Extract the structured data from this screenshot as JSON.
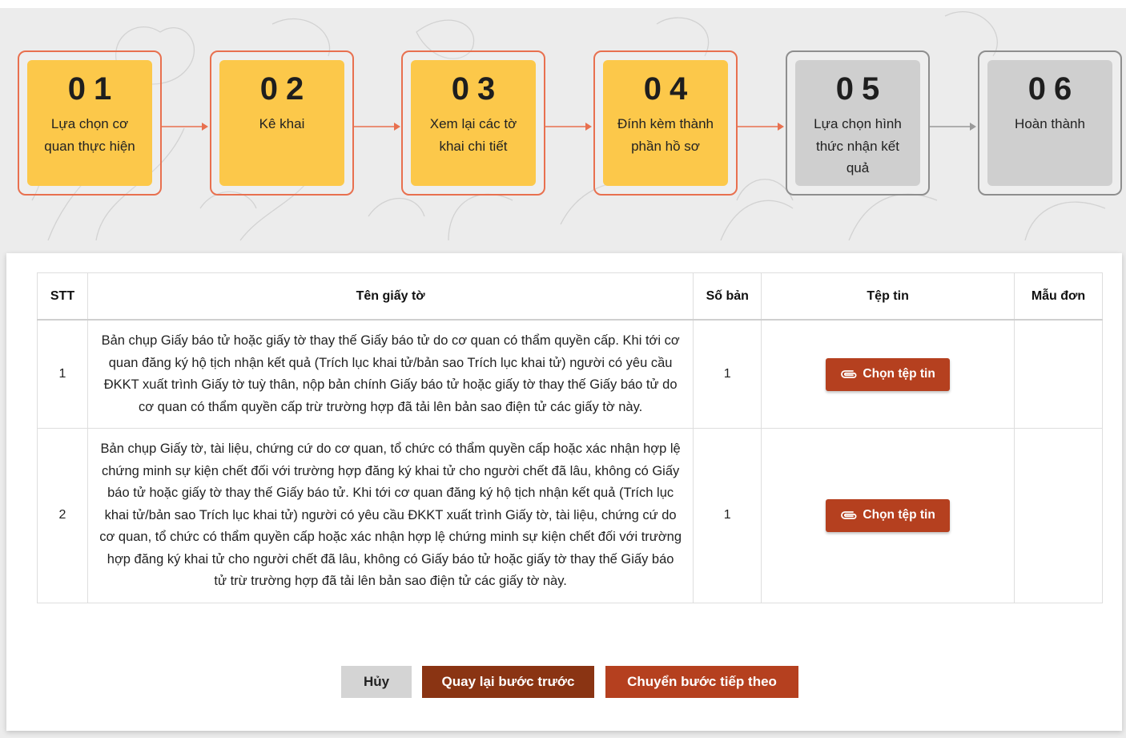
{
  "steps": [
    {
      "num": "01",
      "label": "Lựa chọn cơ quan thực hiện",
      "state": "done"
    },
    {
      "num": "02",
      "label": "Kê khai",
      "state": "done"
    },
    {
      "num": "03",
      "label": "Xem lại các tờ khai chi tiết",
      "state": "done"
    },
    {
      "num": "04",
      "label": "Đính kèm thành phần hồ sơ",
      "state": "active"
    },
    {
      "num": "05",
      "label": "Lựa chọn hình thức nhận kết quả",
      "state": "pending"
    },
    {
      "num": "06",
      "label": "Hoàn thành",
      "state": "pending"
    }
  ],
  "table": {
    "headers": {
      "stt": "STT",
      "name": "Tên giấy tờ",
      "copies": "Số bản",
      "file": "Tệp tin",
      "template": "Mẫu đơn"
    },
    "rows": [
      {
        "stt": "1",
        "name": "Bản chụp Giấy báo tử hoặc giấy tờ thay thế Giấy báo tử do cơ quan có thẩm quyền cấp. Khi tới cơ quan đăng ký hộ tịch nhận kết quả (Trích lục khai tử/bản sao Trích lục khai tử) người có yêu cầu ĐKKT xuất trình Giấy tờ tuỳ thân, nộp bản chính Giấy báo tử hoặc giấy tờ thay thế Giấy báo tử do cơ quan có thẩm quyền cấp trừ trường hợp đã tải lên bản sao điện tử các giấy tờ này.",
        "copies": "1",
        "file_button": "Chọn tệp tin",
        "template": ""
      },
      {
        "stt": "2",
        "name": "Bản chụp Giấy tờ, tài liệu, chứng cứ do cơ quan, tổ chức có thẩm quyền cấp hoặc xác nhận hợp lệ chứng minh sự kiện chết đối với trường hợp đăng ký khai tử cho người chết đã lâu, không có Giấy báo tử hoặc giấy tờ thay thế Giấy báo tử. Khi tới cơ quan đăng ký hộ tịch nhận kết quả (Trích lục khai tử/bản sao Trích lục khai tử) người có yêu cầu ĐKKT xuất trình Giấy tờ, tài liệu, chứng cứ do cơ quan, tổ chức có thẩm quyền cấp hoặc xác nhận hợp lệ chứng minh sự kiện chết đối với trường hợp đăng ký khai tử cho người chết đã lâu, không có Giấy báo tử hoặc giấy tờ thay thế Giấy báo tử trừ trường hợp đã tải lên bản sao điện tử các giấy tờ này.",
        "copies": "1",
        "file_button": "Chọn tệp tin",
        "template": ""
      }
    ]
  },
  "actions": {
    "cancel": "Hủy",
    "back": "Quay lại bước trước",
    "next": "Chuyển bước tiếp theo"
  },
  "icons": {
    "file_button": "paperclip-icon"
  },
  "colors": {
    "step_active_fill": "#fcc84a",
    "step_active_border": "#e8704f",
    "step_pending_fill": "#cfcfcf",
    "step_pending_border": "#8e8e8e",
    "primary_button": "#b5401f",
    "back_button": "#8a3413",
    "cancel_button": "#d4d4d4"
  }
}
